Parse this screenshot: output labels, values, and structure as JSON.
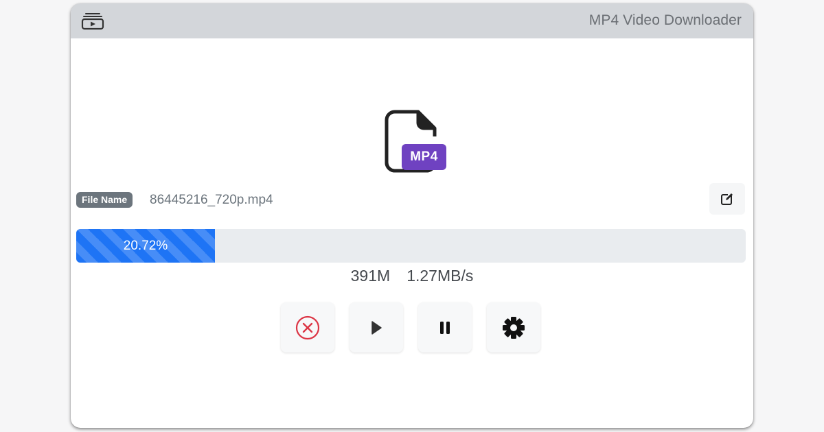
{
  "window": {
    "title": "MP4 Video Downloader",
    "icon": "video-library-icon"
  },
  "file": {
    "type_badge": "MP4",
    "icon": "file-icon",
    "name_label": "File Name",
    "name_value": "86445216_720p.mp4",
    "edit_icon": "edit-icon"
  },
  "progress": {
    "percent": 20.72,
    "label": "20.72%"
  },
  "stats": {
    "size": "391M",
    "speed": "1.27MB/s"
  },
  "controls": [
    {
      "name": "cancel",
      "icon": "close-circle-icon"
    },
    {
      "name": "resume",
      "icon": "play-icon"
    },
    {
      "name": "pause",
      "icon": "pause-icon"
    },
    {
      "name": "settings",
      "icon": "gear-icon"
    }
  ],
  "colors": {
    "titlebar": "#d3d6da",
    "accent_purple": "#6f42c1",
    "progress_blue": "#1e74f5",
    "danger_red": "#dc3545",
    "badge_gray": "#6c757d"
  }
}
